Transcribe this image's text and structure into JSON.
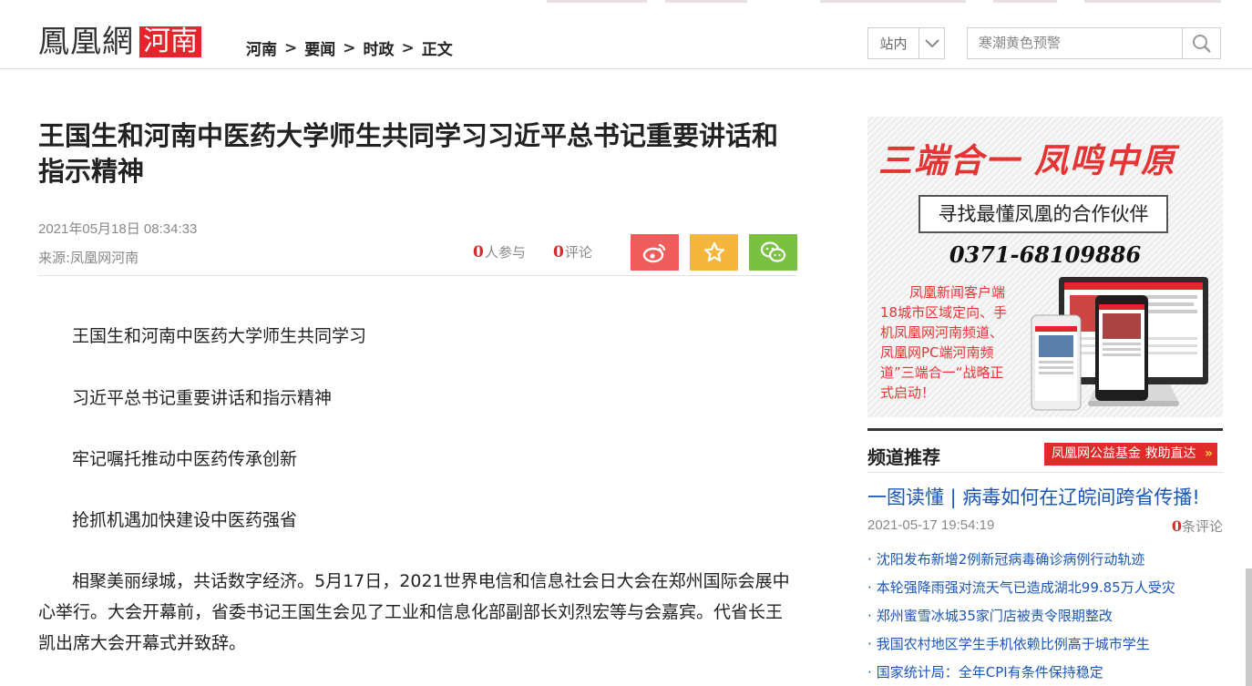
{
  "header": {
    "logo_main": "鳳凰網",
    "logo_sub": "河南",
    "breadcrumb": [
      "河南",
      "要闻",
      "时政",
      "正文"
    ],
    "breadcrumb_sep": ">",
    "site_select": "站内",
    "search_placeholder": "寒潮黄色预警"
  },
  "article": {
    "title": "王国生和河南中医药大学师生共同学习习近平总书记重要讲话和指示精神",
    "date": "2021年05月18日 08:34:33",
    "source_label": "来源:",
    "source_name": "凤凰网河南",
    "participants_count": "0",
    "participants_label": "人参与",
    "comments_count": "0",
    "comments_label": "评论",
    "share": [
      {
        "icon": "weibo-icon",
        "color": "#ef5c5c"
      },
      {
        "icon": "star-icon",
        "color": "#f4b63d"
      },
      {
        "icon": "wechat-icon",
        "color": "#7ac142"
      }
    ],
    "paragraphs": [
      "王国生和河南中医药大学师生共同学习",
      "习近平总书记重要讲话和指示精神",
      "牢记嘱托推动中医药传承创新",
      "抢抓机遇加快建设中医药强省",
      "相聚美丽绿城，共话数字经济。5月17日，2021世界电信和信息社会日大会在郑州国际会展中心举行。大会开幕前，省委书记王国生会见了工业和信息化部副部长刘烈宏等与会嘉宾。代省长王凯出席大会开幕式并致辞。"
    ]
  },
  "ad": {
    "headline": "三端合一  凤鸣中原",
    "box_text": "寻找最懂凤凰的合作伙伴",
    "phone": "0371-68109886",
    "body": "凤凰新闻客户端18城市区域定向、手机凤凰网河南频道、凤凰网PC端河南频道”三端合一“战略正式启动！"
  },
  "sidebar": {
    "title": "频道推荐",
    "banner": "凤凰网公益基金  救助直达",
    "banner_arrow": "»",
    "headline": "一图读懂 | 病毒如何在辽皖间跨省传播!",
    "headline_date": "2021-05-17 19:54:19",
    "headline_comments_count": "0",
    "headline_comments_label": "条评论",
    "items": [
      "沈阳发布新增2例新冠病毒确诊病例行动轨迹",
      "本轮强降雨强对流天气已造成湖北99.85万人受灾",
      "郑州蜜雪冰城35家门店被责令限期整改",
      "我国农村地区学生手机依赖比例高于城市学生",
      "国家统计局：全年CPI有条件保持稳定"
    ]
  },
  "colors": {
    "brand_red": "#e5252c",
    "link_blue": "#1a56b5",
    "ad_red": "#e53434"
  }
}
